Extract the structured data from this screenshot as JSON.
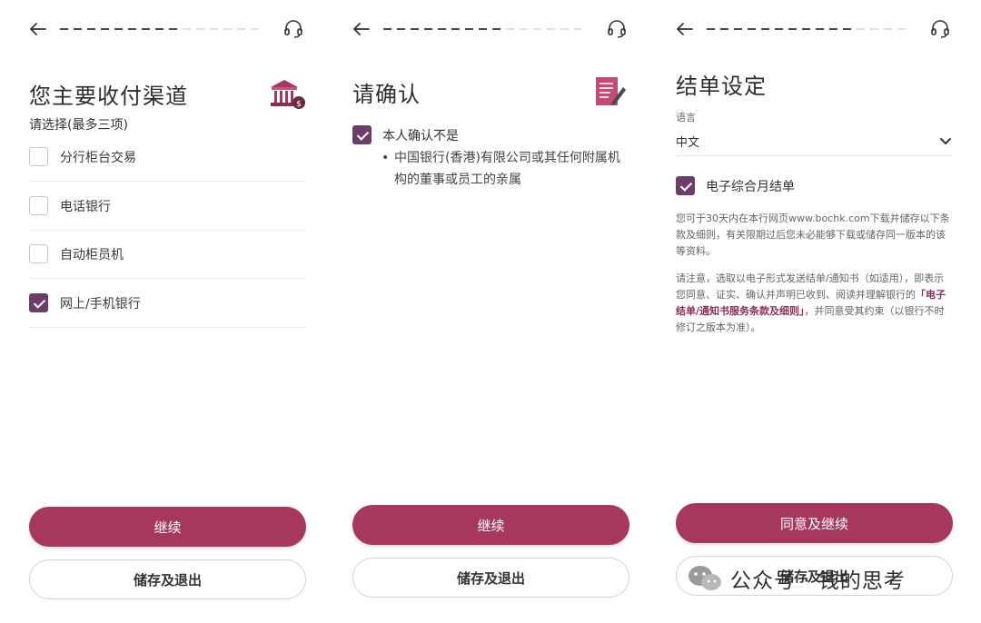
{
  "panel1": {
    "title": "您主要收付渠道",
    "subtitle": "请选择(最多三项)",
    "options": [
      {
        "label": "分行柜台交易",
        "checked": false
      },
      {
        "label": "电话银行",
        "checked": false
      },
      {
        "label": "自动柜员机",
        "checked": false
      },
      {
        "label": "网上/手机银行",
        "checked": true
      }
    ],
    "primary_label": "继续",
    "secondary_label": "储存及退出",
    "icon": "bank-icon"
  },
  "panel2": {
    "title": "请确认",
    "confirm_label": "本人确认不是",
    "bullet_text": "中国银行(香港)有限公司或其任何附属机构的董事或员工的亲属",
    "primary_label": "继续",
    "secondary_label": "储存及退出",
    "icon": "document-edit-icon"
  },
  "panel3": {
    "title": "结单设定",
    "language_label": "语言",
    "language_value": "中文",
    "estmt_label": "电子综合月结单",
    "note1": "您可于30天内在本行网页www.bochk.com下载并储存以下条款及细则，有关限期过后您未必能够下载或储存同一版本的该等资料。",
    "note2_pre": "请注意，选取以电子形式发送结单/通知书（如适用），即表示您同意、证实、确认并声明已收到、阅读并理解银行的",
    "note2_link": "「电子结单/通知书服务条款及细则」",
    "note2_post": "，并同意受其约束（以银行不时修订之版本为准）。",
    "primary_label": "同意及继续",
    "secondary_label": "储存及退出"
  },
  "watermark": "公众号 · 钱的思考",
  "colors": {
    "accent": "#a6385e",
    "checkbox": "#6b3d6b",
    "link": "#8a2f57"
  },
  "icons": [
    "back-arrow-icon",
    "headset-icon",
    "bank-icon",
    "document-edit-icon",
    "chevron-down-icon",
    "wechat-icon"
  ]
}
